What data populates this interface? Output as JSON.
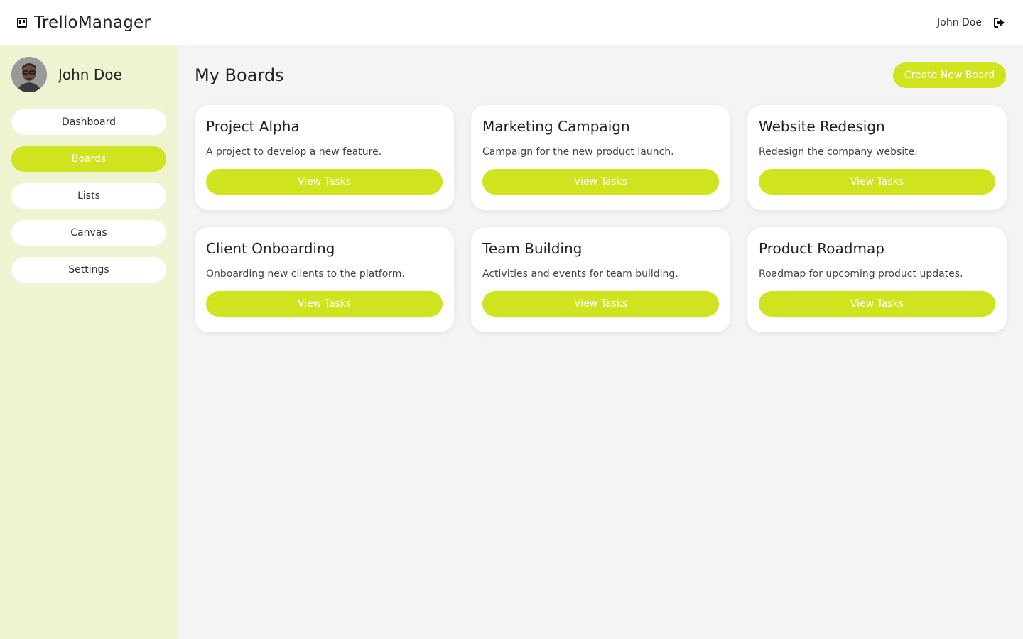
{
  "app": {
    "title": "TrelloManager",
    "brand_icon": "trello-icon"
  },
  "header": {
    "user_name": "John Doe",
    "logout_icon": "sign-out-icon"
  },
  "sidebar": {
    "profile_name": "John Doe",
    "items": [
      {
        "label": "Dashboard",
        "active": false
      },
      {
        "label": "Boards",
        "active": true
      },
      {
        "label": "Lists",
        "active": false
      },
      {
        "label": "Canvas",
        "active": false
      },
      {
        "label": "Settings",
        "active": false
      }
    ]
  },
  "main": {
    "title": "My Boards",
    "create_label": "Create New Board",
    "boards": [
      {
        "title": "Project Alpha",
        "description": "A project to develop a new feature.",
        "button": "View Tasks"
      },
      {
        "title": "Marketing Campaign",
        "description": "Campaign for the new product launch.",
        "button": "View Tasks"
      },
      {
        "title": "Website Redesign",
        "description": "Redesign the company website.",
        "button": "View Tasks"
      },
      {
        "title": "Client Onboarding",
        "description": "Onboarding new clients to the platform.",
        "button": "View Tasks"
      },
      {
        "title": "Team Building",
        "description": "Activities and events for team building.",
        "button": "View Tasks"
      },
      {
        "title": "Product Roadmap",
        "description": "Roadmap for upcoming product updates.",
        "button": "View Tasks"
      }
    ]
  },
  "colors": {
    "accent": "#cfe31e",
    "sidebar_bg": "#eef3d2",
    "page_bg": "#f4f4f4"
  }
}
